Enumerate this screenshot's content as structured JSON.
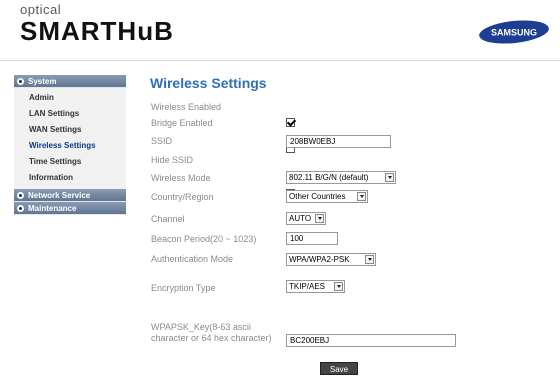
{
  "header": {
    "brand_small": "optical",
    "brand_big": "SMARTHuB",
    "vendor": "SAMSUNG"
  },
  "colors": {
    "title": "#2e6fb8",
    "sidebar_section": "#6f829e",
    "save_button": "#444444"
  },
  "sidebar": {
    "sections": [
      {
        "label": "System",
        "items": [
          "Admin",
          "LAN Settings",
          "WAN Settings",
          "Wireless Settings",
          "Time Settings",
          "Information"
        ],
        "active_item": "Wireless Settings"
      },
      {
        "label": "Network Service",
        "items": []
      },
      {
        "label": "Maintenance",
        "items": []
      }
    ]
  },
  "main": {
    "title": "Wireless Settings",
    "fields": {
      "wireless_enabled": {
        "label": "Wireless Enabled",
        "checked": true
      },
      "bridge_enabled": {
        "label": "Bridge Enabled",
        "checked": false
      },
      "ssid": {
        "label": "SSID",
        "value": "208BW0EBJ"
      },
      "hide_ssid": {
        "label": "Hide SSID",
        "checked": false
      },
      "wireless_mode": {
        "label": "Wireless Mode",
        "value": "802.11 B/G/N (default)"
      },
      "country": {
        "label": "Country/Region",
        "value": "Other Countries"
      },
      "channel": {
        "label": "Channel",
        "value": "AUTO"
      },
      "beacon": {
        "label": "Beacon Period(20 ~ 1023)",
        "value": "100"
      },
      "auth_mode": {
        "label": "Authentication Mode",
        "value": "WPA/WPA2-PSK"
      },
      "encryption": {
        "label": "Encryption Type",
        "value": "TKIP/AES"
      },
      "wpapsk": {
        "label": "WPAPSK_Key(8-63 ascii character or 64 hex character)",
        "value": "BC200EBJ"
      }
    },
    "save_label": "Save"
  }
}
